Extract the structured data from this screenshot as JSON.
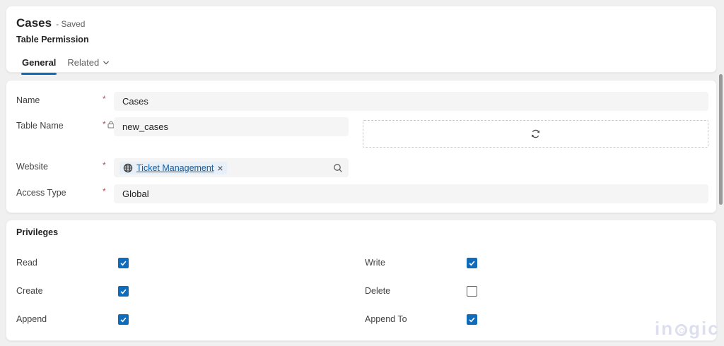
{
  "page": {
    "background": "#f0f0f0",
    "accent": "#0f6cbd",
    "required_marker": "*"
  },
  "header": {
    "record_title": "Cases",
    "record_status": "- Saved",
    "entity_label": "Table Permission",
    "tabs": [
      {
        "label": "General",
        "active": true
      },
      {
        "label": "Related",
        "active": false,
        "has_dropdown": true
      }
    ]
  },
  "form": {
    "fields": [
      {
        "label": "Name",
        "required": true,
        "locked": false,
        "value": "Cases"
      },
      {
        "label": "Table Name",
        "required": true,
        "locked": true,
        "value": "new_cases"
      },
      {
        "label": "Website",
        "required": true,
        "locked": false,
        "type": "lookup",
        "value": "Ticket Management",
        "icons": [
          "globe-icon",
          "remove-icon",
          "search-icon"
        ]
      },
      {
        "label": "Access Type",
        "required": true,
        "locked": false,
        "value": "Global"
      }
    ],
    "refresh_panel": {
      "icon": "refresh-icon"
    }
  },
  "privileges": {
    "section_title": "Privileges",
    "left": [
      {
        "label": "Read",
        "checked": true
      },
      {
        "label": "Create",
        "checked": true
      },
      {
        "label": "Append",
        "checked": true
      }
    ],
    "right": [
      {
        "label": "Write",
        "checked": true
      },
      {
        "label": "Delete",
        "checked": false
      },
      {
        "label": "Append To",
        "checked": true
      }
    ]
  },
  "watermark": {
    "prefix": "in",
    "suffix": "gic"
  }
}
